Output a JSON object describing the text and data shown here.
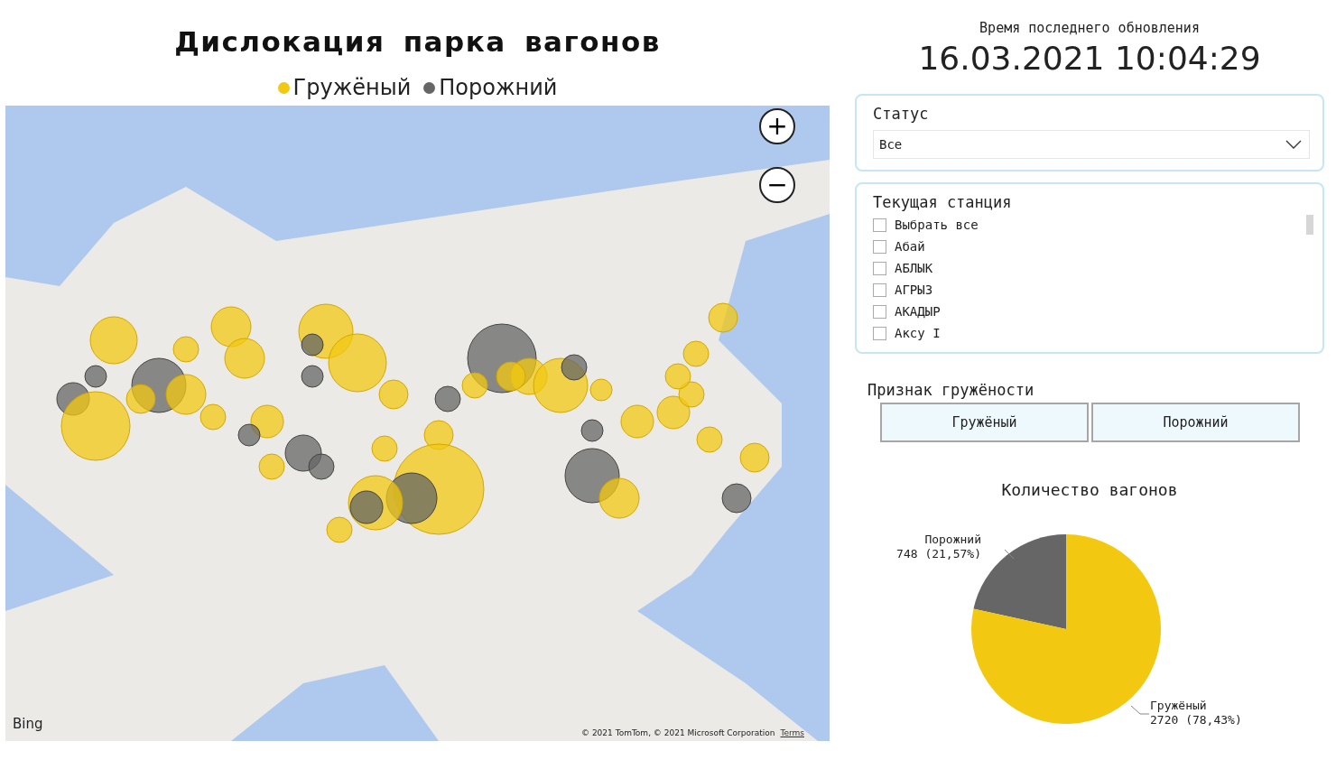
{
  "title": "Дислокация парка вагонов",
  "legend": [
    {
      "label": "Гружёный",
      "color": "#f2c811"
    },
    {
      "label": "Порожний",
      "color": "#666666"
    }
  ],
  "map": {
    "zoom_in": "+",
    "zoom_out": "−",
    "logo": "Bing",
    "copyright": "© 2021 TomTom, © 2021 Microsoft Corporation",
    "terms_link": "Terms"
  },
  "update": {
    "label": "Время последнего обновления",
    "value": "16.03.2021 10:04:29"
  },
  "status_filter": {
    "title": "Статус",
    "value": "Все"
  },
  "station_filter": {
    "title": "Текущая станция",
    "items": [
      {
        "label": "Выбрать все",
        "checked": false
      },
      {
        "label": "Абай",
        "checked": false
      },
      {
        "label": "АБЛЫК",
        "checked": false
      },
      {
        "label": "АГРЫЗ",
        "checked": false
      },
      {
        "label": "АКАДЫР",
        "checked": false
      },
      {
        "label": "Аксу I",
        "checked": false
      }
    ]
  },
  "load_filter": {
    "title": "Признак гружёности",
    "buttons": [
      {
        "label": "Гружёный",
        "selected": false
      },
      {
        "label": "Порожний",
        "selected": false
      }
    ]
  },
  "pie": {
    "chart_data": {
      "type": "pie",
      "title": "Количество вагонов",
      "categories": [
        "Порожний",
        "Гружёный"
      ],
      "colors": [
        "#666666",
        "#f2c811"
      ],
      "values": [
        21.57,
        78.43
      ],
      "value_labels": [
        "748 (21,57%)",
        "2720 (78,43%)"
      ]
    }
  }
}
